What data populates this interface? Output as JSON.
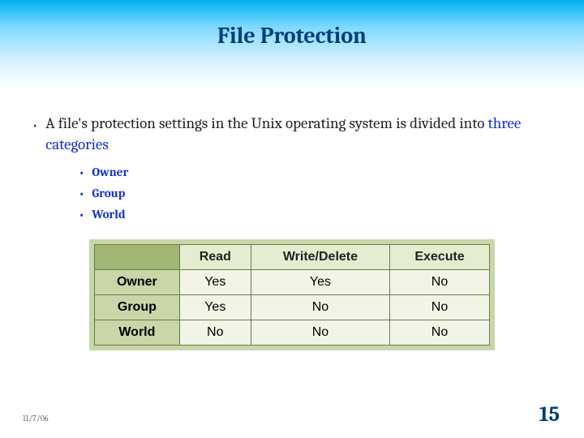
{
  "title": "File Protection",
  "bullet": {
    "pre": "A file's protection settings in the Unix operating system is divided into ",
    "highlight": "three categories"
  },
  "categories": [
    "Owner",
    "Group",
    "World"
  ],
  "table": {
    "columns": [
      "Read",
      "Write/Delete",
      "Execute"
    ],
    "rows": [
      {
        "label": "Owner",
        "cells": [
          "Yes",
          "Yes",
          "No"
        ]
      },
      {
        "label": "Group",
        "cells": [
          "Yes",
          "No",
          "No"
        ]
      },
      {
        "label": "World",
        "cells": [
          "No",
          "No",
          "No"
        ]
      }
    ]
  },
  "footer": {
    "date": "11/7/06",
    "page": "15"
  }
}
